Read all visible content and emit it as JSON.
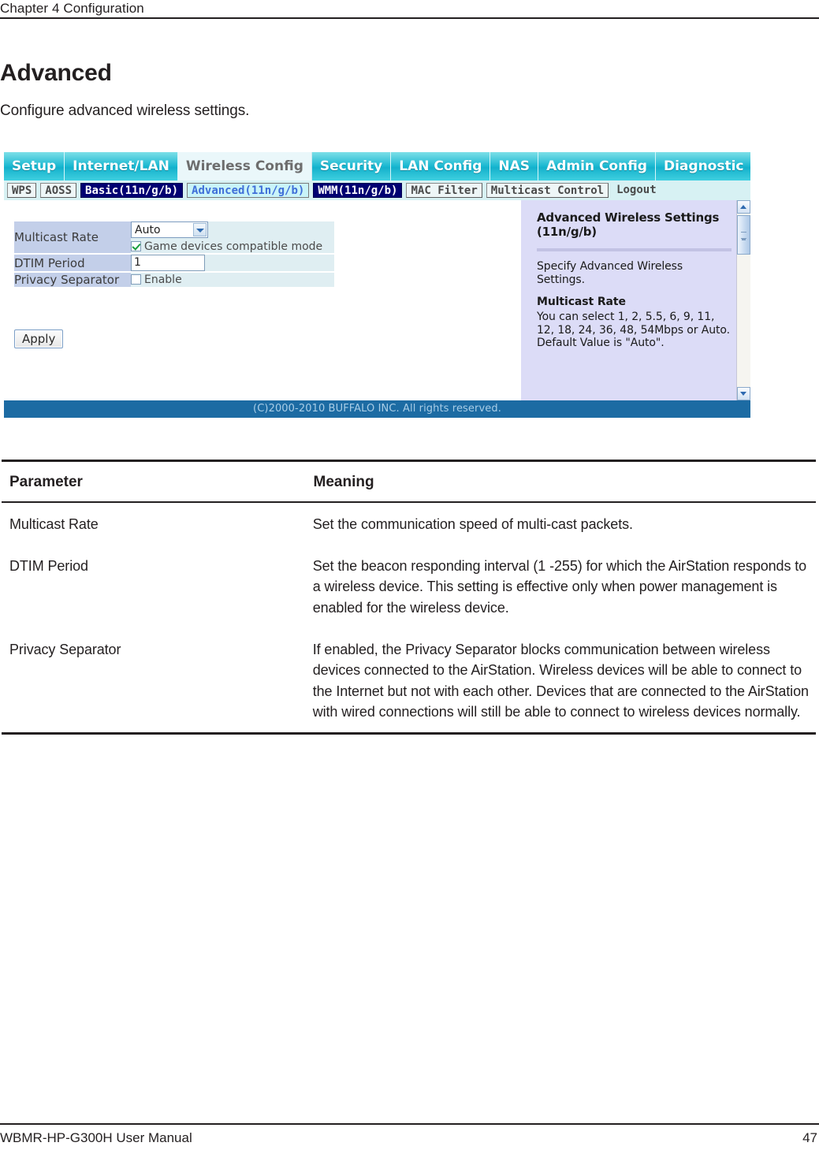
{
  "running_head": "Chapter 4  Configuration",
  "page_title": "Advanced",
  "page_subtitle": "Configure advanced wireless settings.",
  "screenshot": {
    "nav_tabs": [
      {
        "label": "Setup",
        "active": false
      },
      {
        "label": "Internet/LAN",
        "active": false
      },
      {
        "label": "Wireless Config",
        "active": true
      },
      {
        "label": "Security",
        "active": false
      },
      {
        "label": "LAN Config",
        "active": false
      },
      {
        "label": "NAS",
        "active": false
      },
      {
        "label": "Admin Config",
        "active": false
      },
      {
        "label": "Diagnostic",
        "active": false
      }
    ],
    "sub_tabs": [
      {
        "label": "WPS",
        "style": "normal"
      },
      {
        "label": "AOSS",
        "style": "normal"
      },
      {
        "label": "Basic(11n/g/b)",
        "style": "dark"
      },
      {
        "label": "Advanced(11n/g/b)",
        "style": "current"
      },
      {
        "label": "WMM(11n/g/b)",
        "style": "dark"
      },
      {
        "label": "MAC Filter",
        "style": "normal"
      },
      {
        "label": "Multicast Control",
        "style": "normal"
      },
      {
        "label": "Logout",
        "style": "plain"
      }
    ],
    "settings": {
      "multicast_rate": {
        "label": "Multicast Rate",
        "select_value": "Auto",
        "checkbox_label": "Game devices compatible mode",
        "checkbox_checked": true
      },
      "dtim_period": {
        "label": "DTIM Period",
        "value": "1"
      },
      "privacy_separator": {
        "label": "Privacy Separator",
        "checkbox_label": "Enable",
        "checkbox_checked": false
      },
      "apply_label": "Apply"
    },
    "help": {
      "title": "Advanced Wireless Settings (11n/g/b)",
      "title_line1": "Advanced Wireless Settings",
      "title_line2": "(11n/g/b)",
      "intro": "Specify Advanced Wireless Settings.",
      "section_heading": "Multicast Rate",
      "body_line1": "You can select 1, 2, 5.5, 6, 9, 11, 12, 18, 24, 36, 48, 54Mbps or Auto.",
      "body_line2": "Default Value is \"Auto\"."
    },
    "footer_copyright": "(C)2000-2010 BUFFALO INC. All rights reserved.",
    "colors": {
      "nav_cyan": "#15b6d0",
      "subnav_bg": "#d7f1f3",
      "label_cell": "#c3cfe9",
      "value_cell": "#dfeef2",
      "help_bg": "#dcdcf7",
      "footer_bar": "#1c6ba3",
      "dark_tab": "#000072"
    }
  },
  "param_table": {
    "headers": {
      "parameter": "Parameter",
      "meaning": "Meaning"
    },
    "rows": [
      {
        "parameter": "Multicast Rate",
        "meaning": "Set the communication speed of multi-cast packets."
      },
      {
        "parameter": "DTIM Period",
        "meaning": "Set the beacon responding interval (1 -255) for which the AirStation responds to a wireless device. This setting is effective only when power management is enabled for the wireless device."
      },
      {
        "parameter": "Privacy Separator",
        "meaning": "If enabled, the Privacy Separator blocks communication between wireless devices connected to the AirStation. Wireless devices will be able to connect to the Internet but not with each other. Devices that are connected to the AirStation with wired connections will still be able to connect to wireless devices normally."
      }
    ]
  },
  "page_footer": {
    "manual": "WBMR-HP-G300H User Manual",
    "page_number": "47"
  }
}
